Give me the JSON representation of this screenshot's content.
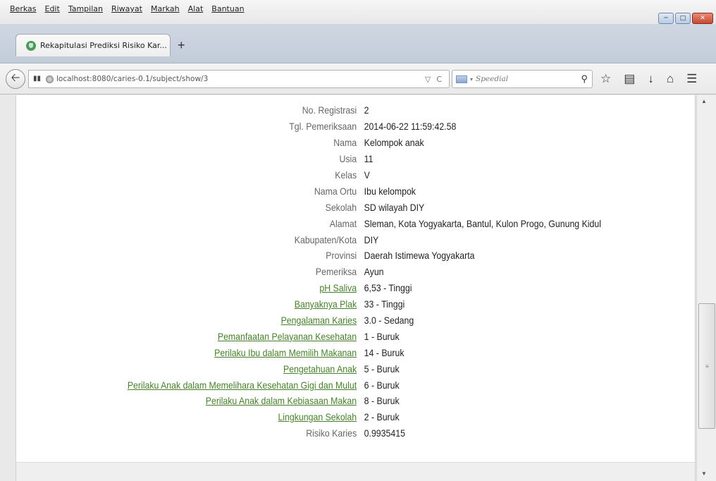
{
  "menu": [
    "Berkas",
    "Edit",
    "Tampilan",
    "Riwayat",
    "Markah",
    "Alat",
    "Bantuan"
  ],
  "tab": {
    "title": "Rekapitulasi Prediksi Risiko Kar..."
  },
  "address": {
    "url": "localhost:8080/caries-0.1/subject/show/3"
  },
  "search": {
    "placeholder": "Speedial"
  },
  "record": [
    {
      "label": "No. Registrasi",
      "value": "2",
      "link": false
    },
    {
      "label": "Tgl. Pemeriksaan",
      "value": "2014-06-22 11:59:42.58",
      "link": false
    },
    {
      "label": "Nama",
      "value": "Kelompok anak",
      "link": false
    },
    {
      "label": "Usia",
      "value": "11",
      "link": false
    },
    {
      "label": "Kelas",
      "value": "V",
      "link": false
    },
    {
      "label": "Nama Ortu",
      "value": "Ibu kelompok",
      "link": false
    },
    {
      "label": "Sekolah",
      "value": "SD wilayah DIY",
      "link": false
    },
    {
      "label": "Alamat",
      "value": "Sleman, Kota Yogyakarta, Bantul, Kulon Progo, Gunung Kidul",
      "link": false
    },
    {
      "label": "Kabupaten/Kota",
      "value": "DIY",
      "link": false
    },
    {
      "label": "Provinsi",
      "value": "Daerah Istimewa Yogyakarta",
      "link": false
    },
    {
      "label": "Pemeriksa",
      "value": "Ayun",
      "link": false
    },
    {
      "label": "pH Saliva",
      "value": "6,53 - Tinggi",
      "link": true
    },
    {
      "label": "Banyaknya Plak",
      "value": "33 - Tinggi",
      "link": true
    },
    {
      "label": "Pengalaman Karies",
      "value": "3.0 - Sedang",
      "link": true
    },
    {
      "label": "Pemanfaatan Pelayanan Kesehatan",
      "value": "1 - Buruk",
      "link": true
    },
    {
      "label": "Perilaku Ibu dalam Memilih Makanan",
      "value": "14 - Buruk",
      "link": true
    },
    {
      "label": "Pengetahuan Anak",
      "value": "5 - Buruk",
      "link": true
    },
    {
      "label": "Perilaku Anak dalam Memelihara Kesehatan Gigi dan Mulut",
      "value": "6 - Buruk",
      "link": true
    },
    {
      "label": "Perilaku Anak dalam Kebiasaan Makan",
      "value": "8 - Buruk",
      "link": true
    },
    {
      "label": "Lingkungan Sekolah",
      "value": "2 - Buruk",
      "link": true
    },
    {
      "label": "Risiko Karies",
      "value": "0.9935415",
      "link": false
    }
  ],
  "colors": {
    "link": "#48802c",
    "label": "#666666"
  }
}
